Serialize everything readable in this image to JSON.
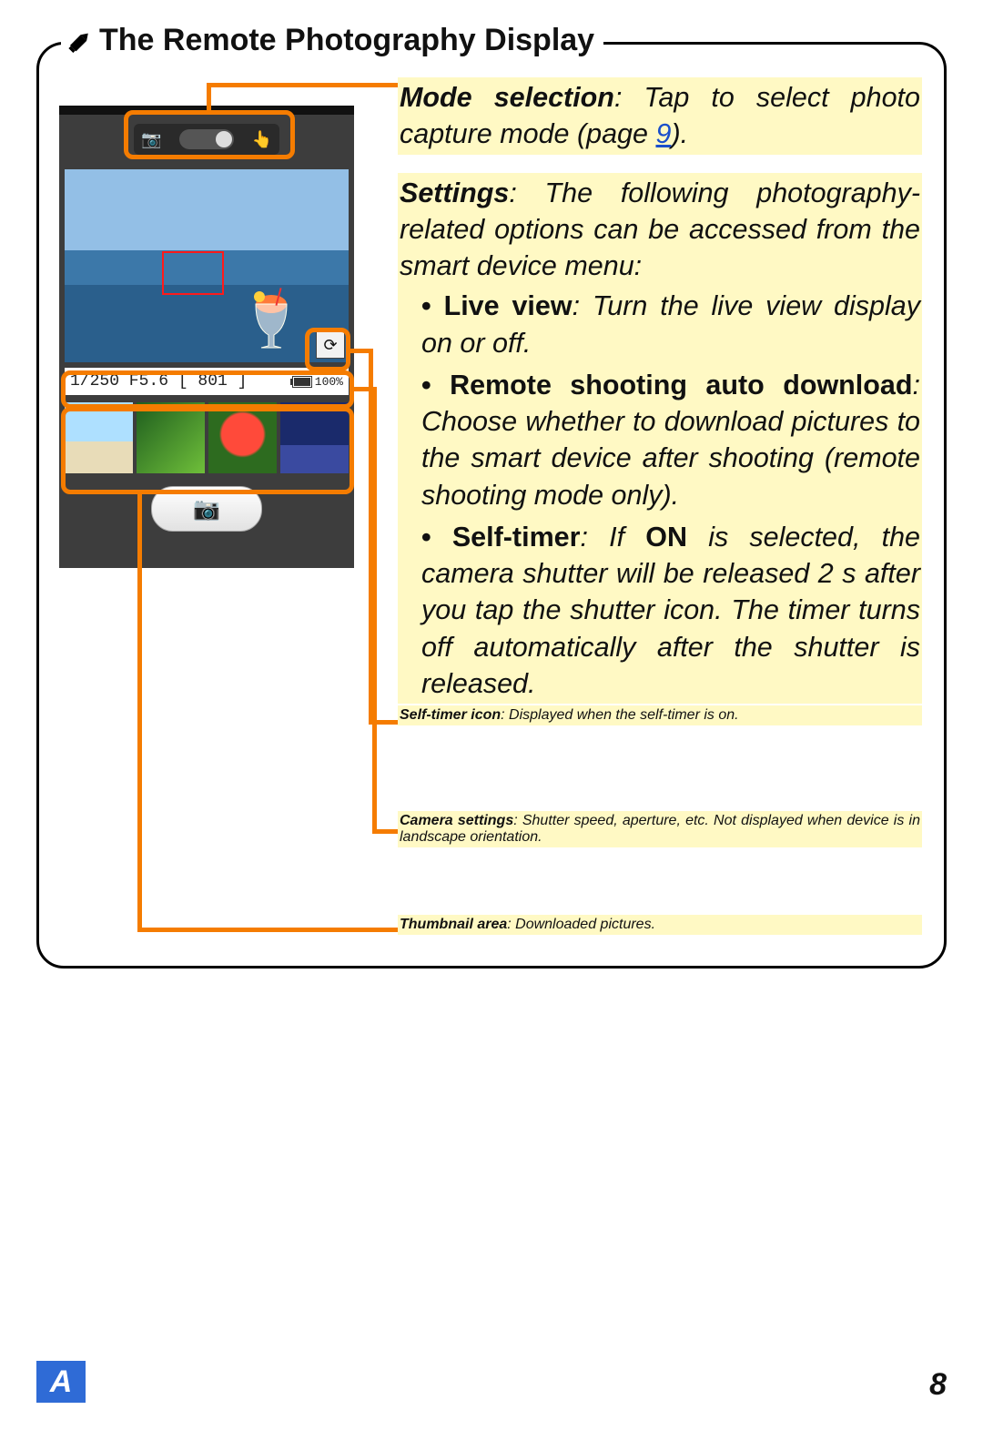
{
  "title": "The Remote Photography Display",
  "page_link_text": "9",
  "mode": {
    "label": "Mode selection",
    "a": ": Tap ",
    "b": " to select photo capture mode (page ",
    "c": ")."
  },
  "settings": {
    "label": "Settings",
    "intro": ": The following photography-related options can be accessed from the smart device menu:",
    "items": [
      {
        "name": "Live view",
        "desc": ": Turn the live view display on or off."
      },
      {
        "name": "Remote shooting auto download",
        "desc": ": Choose whether to download pictures to the smart device after shooting (remote shooting mode only)."
      },
      {
        "name": "Self-timer",
        "desc_a": ": If ",
        "on": "ON",
        "desc_b": " is selected, the camera shutter will be released 2 s after you tap the shutter icon. The timer turns off automatically after the shutter is released."
      }
    ]
  },
  "self_timer_icon": {
    "label": "Self-timer icon",
    "desc": ": Displayed when the self-timer is on."
  },
  "camera_settings": {
    "label": "Camera settings",
    "desc": ": Shutter speed, aperture, etc. Not displayed when device is in landscape orientation."
  },
  "thumbnail_area": {
    "label": "Thumbnail area",
    "desc": ": Downloaded pictures."
  },
  "phone": {
    "settings_strip": "1/250  F5.6  [ 801 ]",
    "battery_pct": "100%",
    "timer_glyph": "⟳"
  },
  "footer": {
    "section": "A",
    "page": "8"
  }
}
